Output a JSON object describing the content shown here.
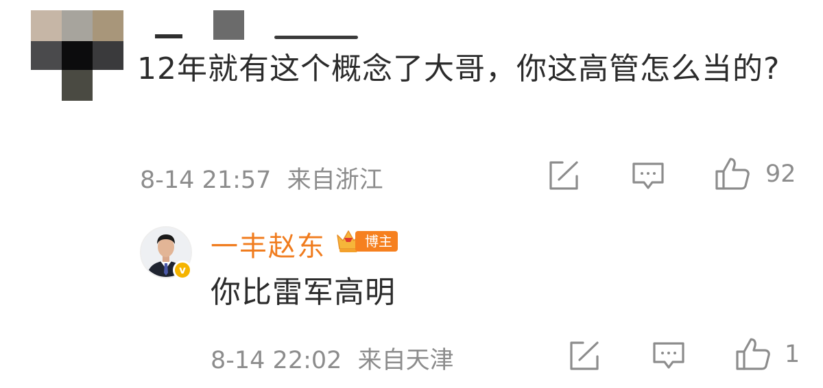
{
  "comment": {
    "text": "12年就有这个概念了大哥，你这高管怎么当的?",
    "time": "8-14 21:57",
    "location": "来自浙江",
    "likes": "92",
    "icons": [
      "share-icon",
      "comment-icon",
      "like-icon"
    ]
  },
  "reply": {
    "author": "一丰赵东",
    "badge": "博主",
    "verify_mark": "v",
    "text": "你比雷军高明",
    "time": "8-14 22:02",
    "location": "来自天津",
    "likes": "1",
    "icons": [
      "share-icon",
      "comment-icon",
      "like-icon"
    ]
  },
  "colors": {
    "text": "#2b2b2b",
    "meta": "#8c8c8c",
    "author": "#f07c1e",
    "badge_bg": "#f6801f",
    "verify": "#f5b400"
  }
}
